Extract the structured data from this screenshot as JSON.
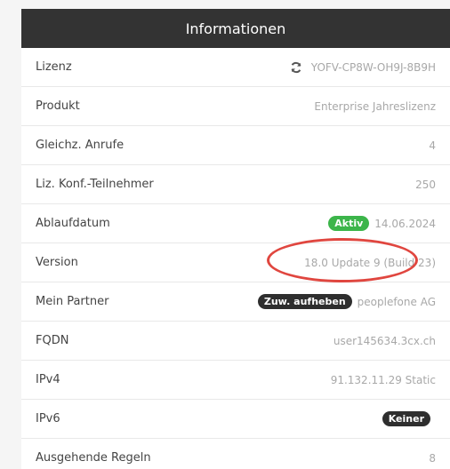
{
  "panel": {
    "title": "Informationen",
    "rows": [
      {
        "label": "Lizenz",
        "value": "YOFV-CP8W-OH9J-8B9H",
        "icon": "refresh-icon"
      },
      {
        "label": "Produkt",
        "value": "Enterprise Jahreslizenz"
      },
      {
        "label": "Gleichz. Anrufe",
        "value": "4"
      },
      {
        "label": "Liz. Konf.-Teilnehmer",
        "value": "250"
      },
      {
        "label": "Ablaufdatum",
        "badge": "Aktiv",
        "value": "14.06.2024"
      },
      {
        "label": "Version",
        "value": "18.0 Update 9 (Build 23)"
      },
      {
        "label": "Mein Partner",
        "badge": "Zuw. aufheben",
        "value": "peoplefone AG"
      },
      {
        "label": "FQDN",
        "value": "user145634.3cx.ch"
      },
      {
        "label": "IPv4",
        "value": "91.132.11.29 Static"
      },
      {
        "label": "IPv6",
        "badge": "Keiner"
      },
      {
        "label": "Ausgehende Regeln",
        "value": "8"
      }
    ]
  },
  "colors": {
    "header_bg": "#333333",
    "badge_active": "#3cb54a",
    "badge_dark": "#2e2e2e",
    "highlight": "#e0463f"
  }
}
